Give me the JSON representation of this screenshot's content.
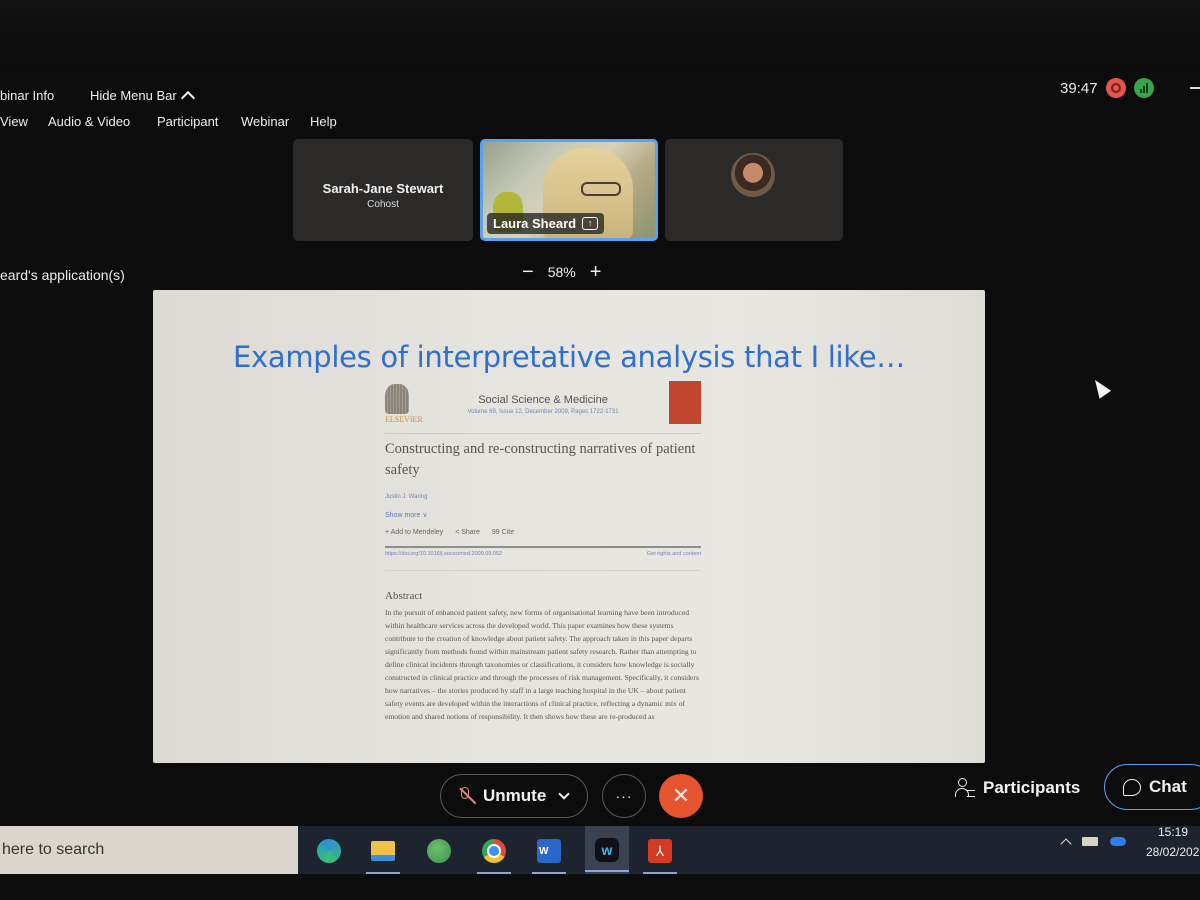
{
  "window": {
    "webinar_info_label": "binar Info",
    "hide_menu_label": "Hide Menu Bar",
    "timer": "39:47",
    "recording_status": "recording",
    "network_status": "good"
  },
  "menu": {
    "items": [
      {
        "label": "View",
        "accel": "V"
      },
      {
        "label": "Audio & Video",
        "accel": "A"
      },
      {
        "label": "Participant",
        "accel": "P"
      },
      {
        "label": "Webinar",
        "accel": "W"
      },
      {
        "label": "Help",
        "accel": "H"
      }
    ]
  },
  "participants": [
    {
      "name": "Sarah-Jane Stewart",
      "role": "Cohost",
      "video": false
    },
    {
      "name": "Laura Sheard",
      "role": "",
      "video": true,
      "sharing": true,
      "active_speaker": true
    },
    {
      "name": "",
      "role": "",
      "video": false,
      "avatar": true
    }
  ],
  "share": {
    "label": "eard's application(s)",
    "zoom_minus": "−",
    "zoom_level": "58%",
    "zoom_plus": "+"
  },
  "slide": {
    "title": "Examples of interpretative analysis that I like…",
    "paper": {
      "publisher": "ELSEVIER",
      "journal": "Social Science & Medicine",
      "journal_meta": "Volume 69, Issue 12, December 2009, Pages 1722-1731",
      "title": "Constructing and re-constructing narratives of patient safety",
      "author": "Justin J. Waring",
      "show_more": "Show more ∨",
      "actions": [
        "+ Add to Mendeley",
        "< Share",
        "99 Cite"
      ],
      "doi": "https://doi.org/10.1016/j.socscimed.2009.09.052",
      "rights": "Get rights and content",
      "abstract_heading": "Abstract",
      "abstract_text": "In the pursuit of enhanced patient safety, new forms of organisational learning have been introduced within healthcare services across the developed world. This paper examines how these systems contribute to the creation of knowledge about patient safety. The approach taken in this paper departs significantly from methods found within mainstream patient safety research. Rather than attempting to define clinical incidents through taxonomies or classifications, it considers how knowledge is socially constructed in clinical practice and through the processes of risk management. Specifically, it considers how narratives – the stories produced by staff in a large teaching hospital in the UK – about patient safety events are developed within the interactions of clinical practice, reflecting a dynamic mix of emotion and shared notions of responsibility. It then shows how these are re-produced as"
    }
  },
  "controls": {
    "unmute_label": "Unmute",
    "more_label": "···",
    "leave_label": "✕",
    "participants_label": "Participants",
    "chat_label": "Chat"
  },
  "taskbar": {
    "search_placeholder": "here to search",
    "apps": [
      "Microsoft Edge",
      "File Explorer",
      "Maps",
      "Google Chrome",
      "Microsoft Word",
      "Webex",
      "Adobe Acrobat"
    ],
    "active_app": "Webex",
    "word_letter": "W",
    "time": "15:19",
    "date": "28/02/202"
  },
  "colors": {
    "slide_title": "#2f6fcf",
    "leave": "#e5532f",
    "active_border": "#5aa1ee",
    "recording": "#e2554d",
    "network": "#3aa44d"
  }
}
